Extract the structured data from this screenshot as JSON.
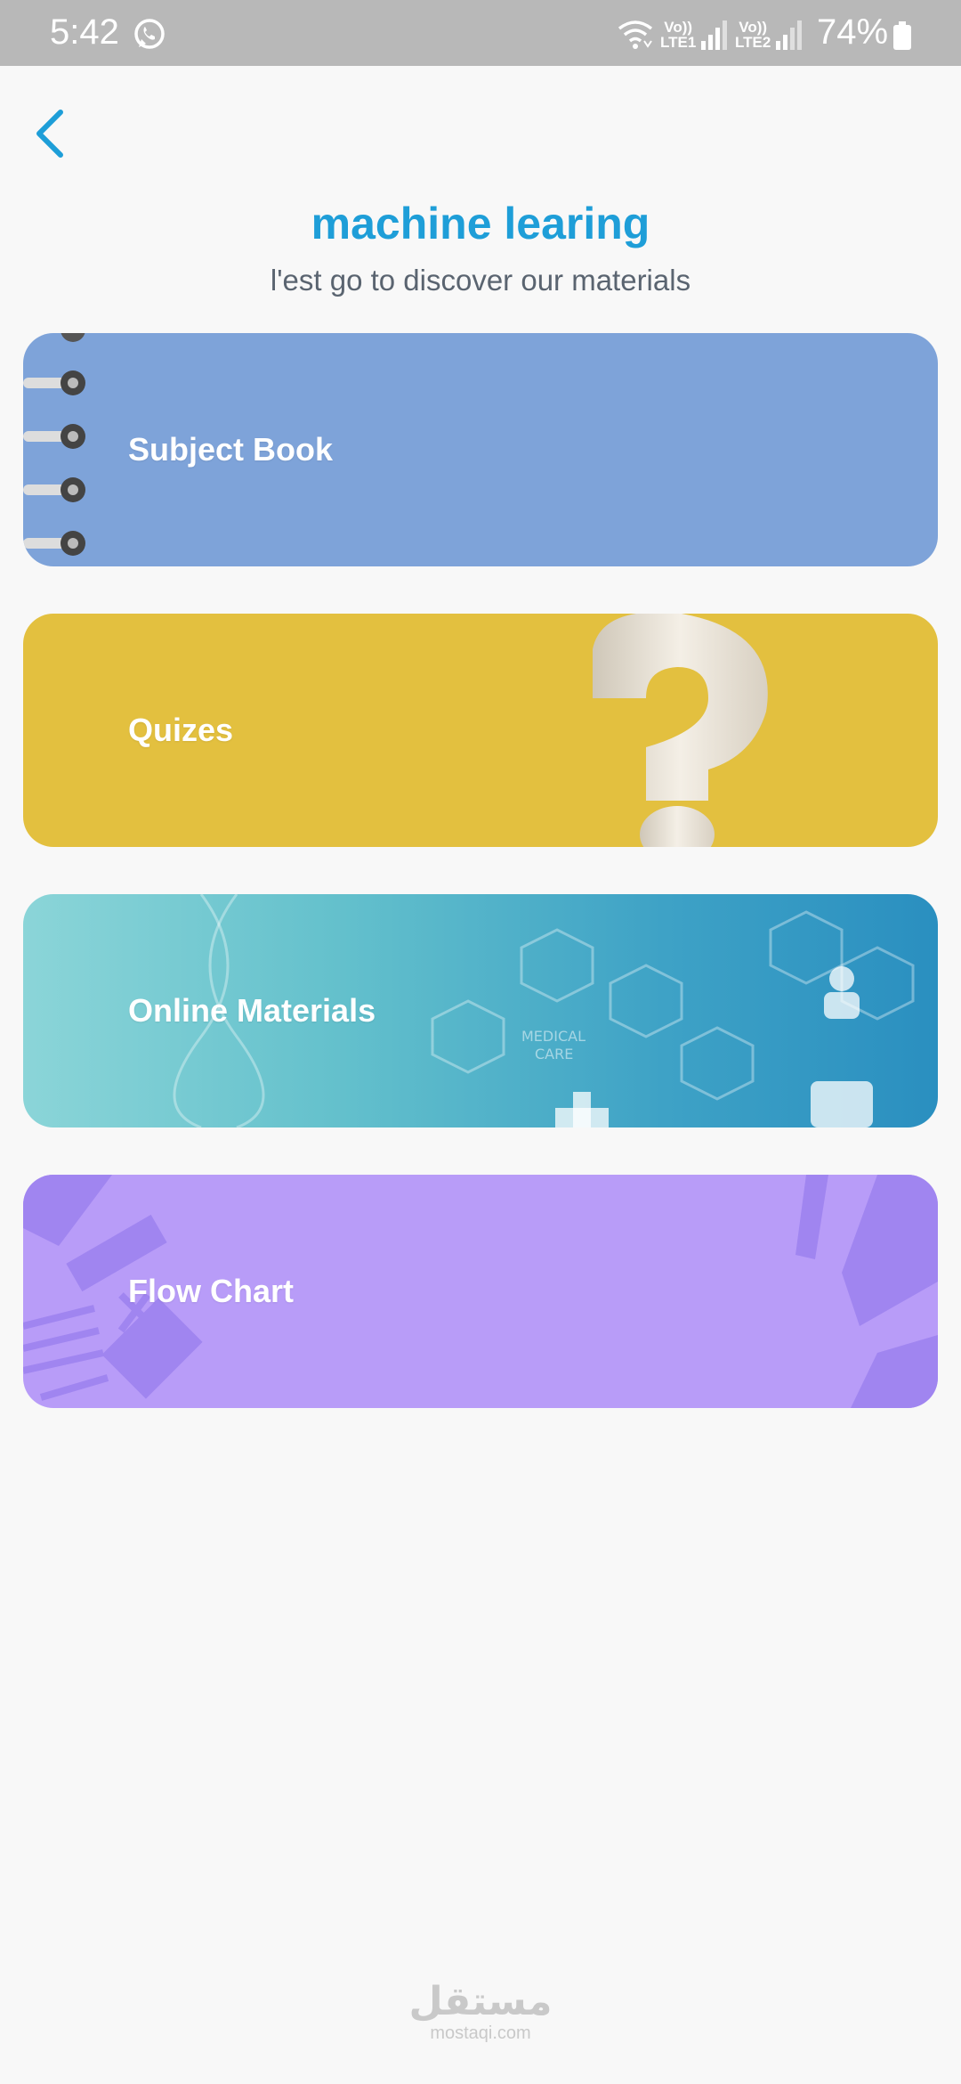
{
  "status_bar": {
    "time": "5:42",
    "sim1_top": "Vo))",
    "sim1_bottom": "LTE1",
    "sim2_top": "Vo))",
    "sim2_bottom": "LTE2",
    "battery": "74%",
    "icons": [
      "whatsapp-icon",
      "wifi-icon",
      "signal-icon",
      "battery-icon"
    ]
  },
  "header": {
    "back_icon": "chevron-left-icon",
    "title": "machine learing",
    "subtitle": "l'est go to discover our materials"
  },
  "cards": [
    {
      "label": "Subject Book",
      "color": "#7ea3d9"
    },
    {
      "label": "Quizes",
      "color": "#e3c03f"
    },
    {
      "label": "Online Materials",
      "color": "#3ea2c6"
    },
    {
      "label": "Flow Chart",
      "color": "#b89cf8"
    }
  ],
  "watermark": {
    "arabic": "مستقل",
    "latin": "mostaqi.com"
  },
  "colors": {
    "accent": "#1e9ed8",
    "background": "#f8f8f8",
    "status_bar": "#b8b8b8"
  }
}
